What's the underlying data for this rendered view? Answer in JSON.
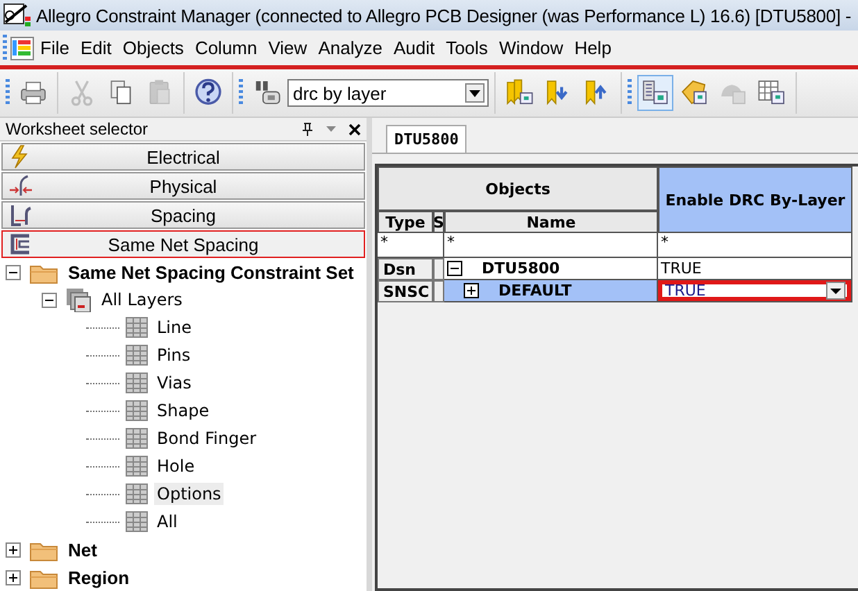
{
  "window": {
    "title": "Allegro Constraint Manager (connected to Allegro PCB Designer (was Performance L) 16.6) [DTU5800] -"
  },
  "menu": [
    "File",
    "Edit",
    "Objects",
    "Column",
    "View",
    "Analyze",
    "Audit",
    "Tools",
    "Window",
    "Help"
  ],
  "toolbar": {
    "groups": [
      [
        {
          "disabled": false,
          "selected": false
        }
      ],
      [
        {
          "disabled": true,
          "selected": false
        },
        {
          "disabled": false,
          "selected": false
        },
        {
          "disabled": true,
          "selected": false
        }
      ],
      [
        {
          "disabled": false,
          "selected": false
        }
      ],
      [
        {
          "disabled": false,
          "selected": false
        },
        {
          "kind": "dropdown",
          "value": "drc by layer"
        }
      ],
      [
        {
          "disabled": false,
          "selected": false
        },
        {
          "disabled": false,
          "selected": false
        },
        {
          "disabled": false,
          "selected": false
        }
      ],
      [
        {
          "disabled": false,
          "selected": true
        },
        {
          "disabled": false,
          "selected": false
        },
        {
          "disabled": true,
          "selected": false
        },
        {
          "disabled": false,
          "selected": false
        }
      ]
    ]
  },
  "worksheet_selector": {
    "title": "Worksheet selector",
    "items": [
      {
        "label": "Electrical",
        "selected": false
      },
      {
        "label": "Physical",
        "selected": false
      },
      {
        "label": "Spacing",
        "selected": false
      },
      {
        "label": "Same Net Spacing",
        "selected": true
      }
    ],
    "tree": [
      {
        "label": "Same Net Spacing Constraint Set",
        "kind": "folder",
        "expanded": true,
        "selected": false,
        "children": [
          {
            "label": "All Layers",
            "kind": "layers",
            "expanded": true,
            "selected": false,
            "children": [
              {
                "label": "Line",
                "kind": "sheet",
                "selected": false
              },
              {
                "label": "Pins",
                "kind": "sheet",
                "selected": false
              },
              {
                "label": "Vias",
                "kind": "sheet",
                "selected": false
              },
              {
                "label": "Shape",
                "kind": "sheet",
                "selected": false
              },
              {
                "label": "Bond Finger",
                "kind": "sheet",
                "selected": false
              },
              {
                "label": "Hole",
                "kind": "sheet",
                "selected": false
              },
              {
                "label": "Options",
                "kind": "sheet",
                "selected": true
              },
              {
                "label": "All",
                "kind": "sheet",
                "selected": false
              }
            ]
          }
        ]
      },
      {
        "label": "Net",
        "kind": "folder",
        "expanded": false,
        "selected": false
      },
      {
        "label": "Region",
        "kind": "folder",
        "expanded": false,
        "selected": false
      }
    ]
  },
  "worksheet": {
    "tabs": [
      {
        "label": "DTU5800",
        "selected": true
      }
    ],
    "group_header": "Objects",
    "columns": [
      {
        "label": "Type"
      },
      {
        "label": "S"
      },
      {
        "label": "Name"
      },
      {
        "label": "Enable DRC By-Layer",
        "selected": true
      }
    ],
    "filter_row": {
      "type": "*",
      "name": "*",
      "value": "*"
    },
    "rows": [
      {
        "type": "Dsn",
        "name": "DTU5800",
        "expanded": true,
        "value": "TRUE",
        "selected": false,
        "editing": false
      },
      {
        "type": "SNSC",
        "name": "DEFAULT",
        "expanded": false,
        "value": "TRUE",
        "selected": true,
        "editing": true
      }
    ]
  }
}
